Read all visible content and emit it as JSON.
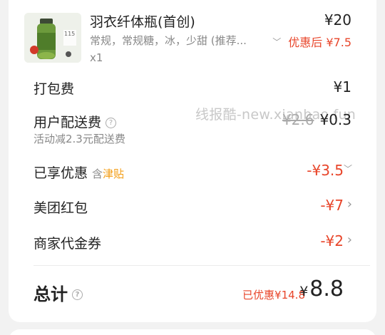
{
  "product": {
    "name": "羽衣纤体瓶(首创)",
    "spec": "常规，常规糖，冰，少甜 (推荐...",
    "qty": "x1",
    "price": "¥20",
    "discount_price": "优惠后 ¥7.5",
    "thumb_label": "115"
  },
  "packing": {
    "label": "打包费",
    "value": "¥1"
  },
  "delivery": {
    "label": "用户配送费",
    "original": "¥2.6",
    "value": "¥0.3",
    "note": "活动减2.3元配送费"
  },
  "enjoyed": {
    "label": "已享优惠",
    "included_prefix": "含",
    "included_tag": "津贴",
    "value": "-¥3.5"
  },
  "redpacket": {
    "label": "美团红包",
    "value": "-¥7"
  },
  "voucher": {
    "label": "商家代金券",
    "value": "-¥2"
  },
  "total": {
    "label": "总计",
    "saved": "已优惠¥14.8",
    "currency": "¥",
    "value": "8.8"
  },
  "watermark": "线报酷-new.xianbao.fun",
  "colors": {
    "accent_red": "#e8452a",
    "tag_orange": "#f39c12"
  }
}
